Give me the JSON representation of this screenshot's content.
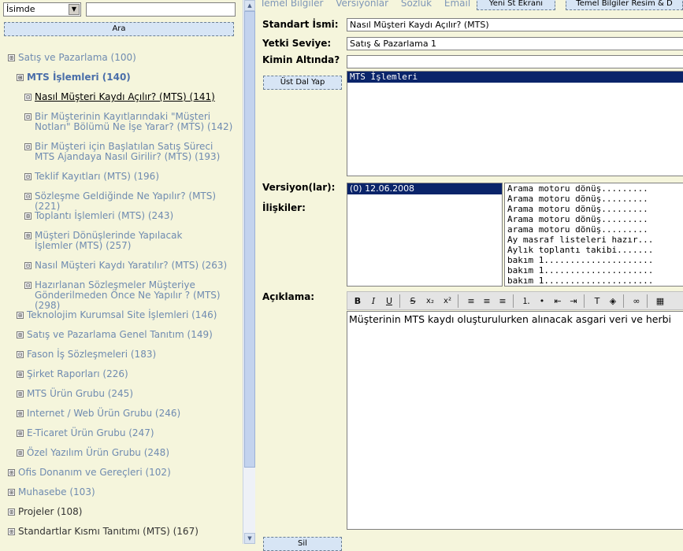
{
  "search": {
    "select_value": "İsimde",
    "button_label": "Ara"
  },
  "tree": [
    {
      "label": "Satış ve Pazarlama (100)",
      "toggle": "⊞"
    },
    {
      "label": "MTS İşlemleri (140)",
      "toggle": "⊞"
    },
    {
      "label": "Nasıl Müşteri Kaydı Açılır? (MTS) (141)",
      "toggle": "⊟"
    },
    {
      "label": "Bir Müşterinin Kayıtlarındaki \"Müşteri Notları\" Bölümü Ne İşe Yarar? (MTS) (142)",
      "toggle": "⊟"
    },
    {
      "label": "Bir Müşteri için Başlatılan Satış Süreci MTS Ajandaya Nasıl Girilir? (MTS) (193)",
      "toggle": "⊟"
    },
    {
      "label": "Teklif Kayıtları (MTS) (196)",
      "toggle": "⊟"
    },
    {
      "label": "Sözleşme Geldiğinde Ne Yapılır? (MTS) (221)",
      "toggle": "⊟"
    },
    {
      "label": "Toplantı İşlemleri (MTS) (243)",
      "toggle": "⊞"
    },
    {
      "label": "Müşteri Dönüşlerinde Yapılacak İşlemler (MTS) (257)",
      "toggle": "⊞"
    },
    {
      "label": "Nasıl Müşteri Kaydı Yaratılır? (MTS) (263)",
      "toggle": "⊟"
    },
    {
      "label": "Hazırlanan Sözleşmeler Müşteriye Gönderilmeden Önce Ne Yapılır ? (MTS) (298)",
      "toggle": "⊟"
    },
    {
      "label": "Teknolojim Kurumsal Site İşlemleri (146)",
      "toggle": "⊞"
    },
    {
      "label": "Satış ve Pazarlama Genel Tanıtım (149)",
      "toggle": "⊞"
    },
    {
      "label": "Fason İş Sözleşmeleri (183)",
      "toggle": "⊟"
    },
    {
      "label": "Şirket Raporları (226)",
      "toggle": "⊞"
    },
    {
      "label": "MTS Ürün Grubu (245)",
      "toggle": "⊞"
    },
    {
      "label": "Internet / Web Ürün Grubu (246)",
      "toggle": "⊞"
    },
    {
      "label": "E-Ticaret Ürün Grubu (247)",
      "toggle": "⊞"
    },
    {
      "label": "Özel Yazılım Ürün Grubu (248)",
      "toggle": "⊞"
    },
    {
      "label": "Ofis Donanım ve Gereçleri (102)",
      "toggle": "⊞"
    },
    {
      "label": "Muhasebe (103)",
      "toggle": "⊞"
    },
    {
      "label": "Projeler (108)",
      "toggle": "⊞"
    },
    {
      "label": "Standartlar Kısmı Tanıtımı (MTS) (167)",
      "toggle": "⊞"
    }
  ],
  "tabs": {
    "temel": "Temel Bilgiler",
    "versiyonlar": "Versiyonlar",
    "sozluk": "Sözlük",
    "email": "Email"
  },
  "top_buttons": {
    "yeni": "Yeni St Ekranı",
    "resim": "Temel Bilgiler Resim & D"
  },
  "form": {
    "standart_label": "Standart İsmi:",
    "standart_value": "Nasıl Müşteri Kaydı Açılır? (MTS)",
    "yetki_label": "Yetki Seviye:",
    "yetki_value": "Satış & Pazarlama 1",
    "kimin_label": "Kimin Altında?",
    "kimin_value": "",
    "ust_dal_button": "Üst Dal Yap",
    "parent_selected": "MTS İşlemleri",
    "versiyon_label": "Versiyon(lar):",
    "iliskiler_label": "İlişkiler:",
    "version_selected": "(0) 12.06.2008",
    "relations": [
      "Arama motoru dönüş.........",
      "Arama motoru dönüş.........",
      "Arama motoru dönüş.........",
      "Arama motoru dönüş.........",
      "arama motoru dönüş.........",
      "Ay masraf listeleri hazır...",
      "Aylık toplantı takibi.......",
      "bakım 1.....................",
      "bakım 1.....................",
      "bakım 1....................."
    ],
    "aciklama_label": "Açıklama:",
    "editor_text": "Müşterinin MTS kaydı oluşturulurken alınacak asgari veri ve herbi",
    "save_button": "Sil"
  }
}
